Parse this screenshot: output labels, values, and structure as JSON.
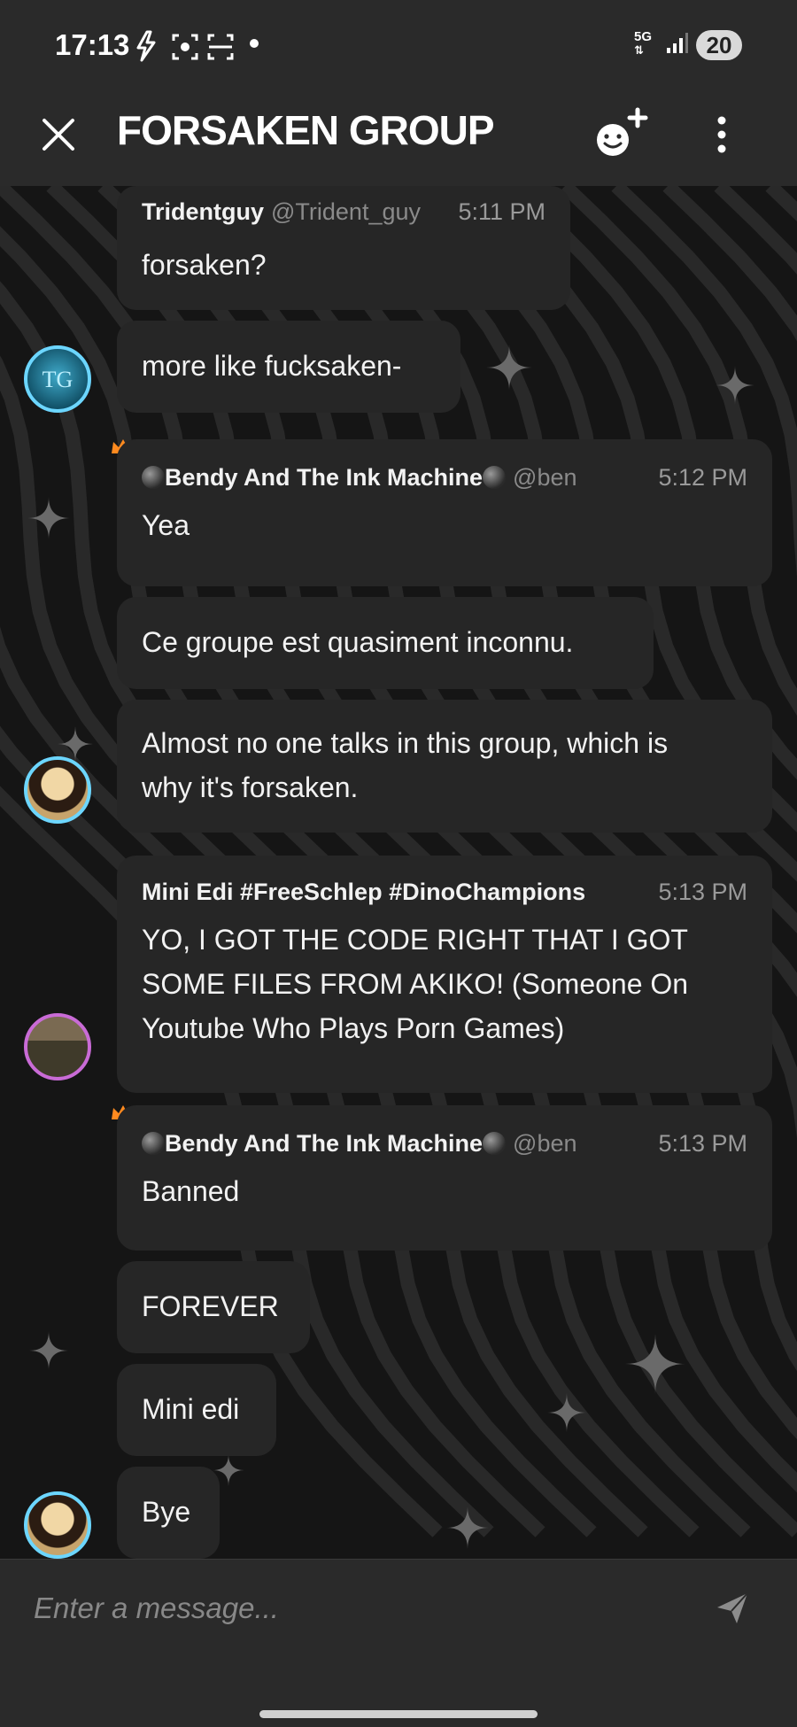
{
  "status_bar": {
    "time": "17:13",
    "network": "5G",
    "battery": "20",
    "left_icons": [
      "bolt-icon",
      "screen-record-icon",
      "scan-icon"
    ]
  },
  "header": {
    "title": "FORSAKEN GROUP",
    "close_icon": "close-icon",
    "invite_icon": "invite-member-icon",
    "more_icon": "more-vertical-icon"
  },
  "messages": [
    {
      "author": "Tridentguy",
      "handle": "@Trident_guy",
      "time": "5:11 PM",
      "text": "forsaken?"
    },
    {
      "text": "more like fucksaken-"
    },
    {
      "author": "Bendy And The Ink Machine",
      "handle": "@ben",
      "time": "5:12 PM",
      "text": "Yea"
    },
    {
      "text": "Ce groupe est quasiment inconnu."
    },
    {
      "text": "Almost no one talks in this group, which is why it's forsaken."
    },
    {
      "author": "Mini Edi #FreeSchlep #DinoChampions",
      "time": "5:13 PM",
      "text": "YO, I GOT THE CODE RIGHT THAT I GOT SOME FILES FROM AKIKO! (Someone On Youtube Who Plays Porn Games)"
    },
    {
      "author": "Bendy And The Ink Machine",
      "handle": "@ben",
      "time": "5:13 PM",
      "text": "Banned"
    },
    {
      "text": "FOREVER"
    },
    {
      "text": "Mini edi"
    },
    {
      "text": "Bye"
    }
  ],
  "avatars": {
    "tridentguy_initials": "TG"
  },
  "composer": {
    "placeholder": "Enter a message...",
    "send_icon": "send-icon"
  },
  "colors": {
    "background": "#151515",
    "bar": "#2a2a2a",
    "bubble": "#262626",
    "avatar_ring": "#6cd6ff",
    "crown": "#ff8a1f"
  }
}
